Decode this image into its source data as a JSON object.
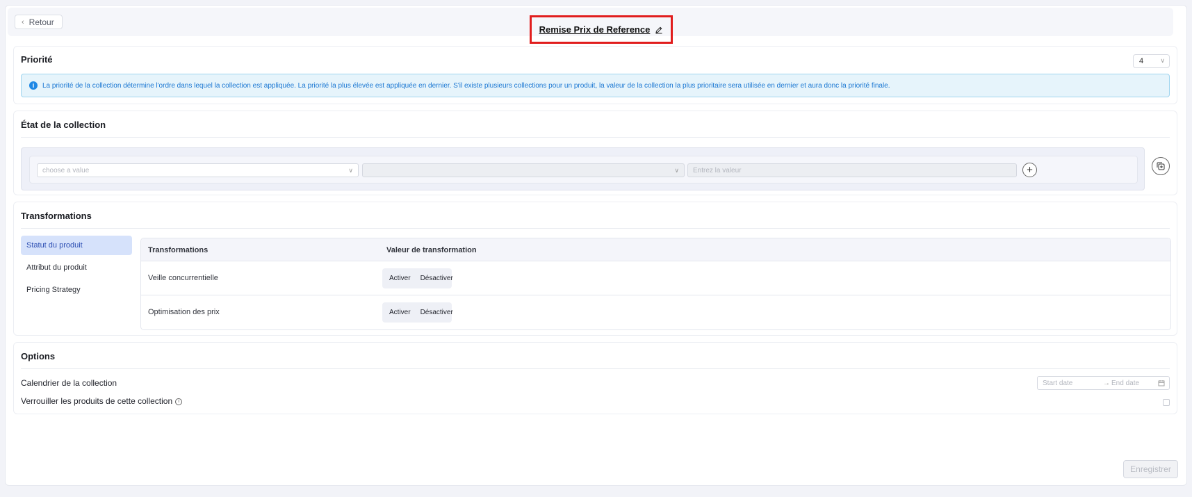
{
  "header": {
    "back_label": "Retour",
    "title": "Remise Prix de Reference"
  },
  "priority": {
    "title": "Priorité",
    "selected_value": "4",
    "info_text": "La priorité de la collection détermine l'ordre dans lequel la collection est appliquée. La priorité la plus élevée est appliquée en dernier. S'il existe plusieurs collections pour un produit, la valeur de la collection la plus prioritaire sera utilisée en dernier et aura donc la priorité finale."
  },
  "collection_state": {
    "title": "État de la collection",
    "field1_placeholder": "choose a value",
    "field2_placeholder": "",
    "value_placeholder": "Entrez la valeur"
  },
  "transformations": {
    "title": "Transformations",
    "tabs": [
      {
        "label": "Statut du produit",
        "active": true
      },
      {
        "label": "Attribut du produit",
        "active": false
      },
      {
        "label": "Pricing Strategy",
        "active": false
      }
    ],
    "columns": [
      "Transformations",
      "Valeur de transformation"
    ],
    "rows": [
      {
        "name": "Veille concurrentielle",
        "activate": "Activer",
        "deactivate": "Désactiver"
      },
      {
        "name": "Optimisation des prix",
        "activate": "Activer",
        "deactivate": "Désactiver"
      }
    ]
  },
  "options": {
    "title": "Options",
    "calendar_label": "Calendrier de la collection",
    "start_placeholder": "Start date",
    "end_placeholder": "End date",
    "lock_label": "Verrouiller les produits de cette collection"
  },
  "footer": {
    "save_label": "Enregistrer"
  },
  "colors": {
    "highlight_border": "#e11d1d",
    "active_tab_bg": "#d6e2fb",
    "info_bg": "#e6f4fb",
    "info_text": "#1976d2"
  }
}
